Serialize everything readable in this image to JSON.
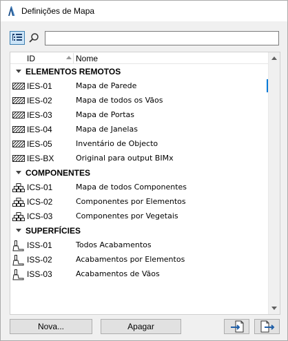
{
  "window": {
    "title": "Definições de Mapa"
  },
  "search": {
    "value": "",
    "placeholder": ""
  },
  "columns": {
    "id": "ID",
    "name": "Nome"
  },
  "groups": [
    {
      "label": "ELEMENTOS REMOTOS",
      "icon": "hatch-icon",
      "items": [
        {
          "id": "IES-01",
          "name": "Mapa de Parede",
          "selected": true
        },
        {
          "id": "IES-02",
          "name": "Mapa de todos os Vãos"
        },
        {
          "id": "IES-03",
          "name": "Mapa de Portas"
        },
        {
          "id": "IES-04",
          "name": "Mapa de Janelas"
        },
        {
          "id": "IES-05",
          "name": "Inventário de Objecto"
        },
        {
          "id": "IES-BX",
          "name": "Original para output BIMx"
        }
      ]
    },
    {
      "label": "COMPONENTES",
      "icon": "bricks-icon",
      "items": [
        {
          "id": "ICS-01",
          "name": "Mapa de todos Componentes"
        },
        {
          "id": "ICS-02",
          "name": "Componentes por Elementos"
        },
        {
          "id": "ICS-03",
          "name": "Componentes por Vegetais"
        }
      ]
    },
    {
      "label": "SUPERFÍCIES",
      "icon": "paint-brush-icon",
      "items": [
        {
          "id": "ISS-01",
          "name": "Todos Acabamentos"
        },
        {
          "id": "ISS-02",
          "name": "Acabamentos por Elementos"
        },
        {
          "id": "ISS-03",
          "name": "Acabamentos de Vãos"
        }
      ]
    }
  ],
  "buttons": {
    "new": "Nova...",
    "delete": "Apagar"
  },
  "colors": {
    "accent": "#0078d7",
    "toolbar_active_bg": "#cce4f7"
  }
}
